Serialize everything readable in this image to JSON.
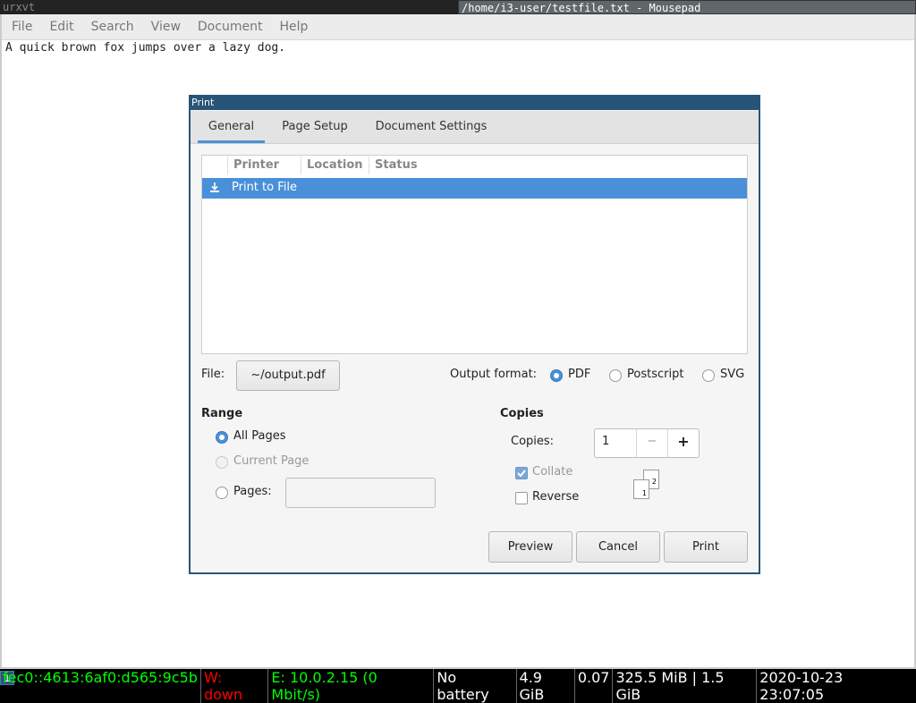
{
  "window_titles": {
    "left": "urxvt",
    "right": "/home/i3-user/testfile.txt - Mousepad"
  },
  "menubar": [
    "File",
    "Edit",
    "Search",
    "View",
    "Document",
    "Help"
  ],
  "editor": {
    "text": "A quick brown fox jumps over a lazy dog."
  },
  "dialog": {
    "title": "Print",
    "tabs": [
      {
        "label": "General",
        "active": true
      },
      {
        "label": "Page Setup",
        "active": false
      },
      {
        "label": "Document Settings",
        "active": false
      }
    ],
    "printer_list": {
      "columns": [
        "Printer",
        "Location",
        "Status"
      ],
      "rows": [
        {
          "icon": "download-icon",
          "name": "Print to File",
          "selected": true
        }
      ]
    },
    "file": {
      "label": "File:",
      "value": "~/output.pdf"
    },
    "output_format": {
      "label": "Output format:",
      "options": [
        "PDF",
        "Postscript",
        "SVG"
      ],
      "selected": "PDF"
    },
    "range": {
      "title": "Range",
      "options": [
        "All Pages",
        "Current Page",
        "Pages:"
      ],
      "selected": "All Pages",
      "pages_value": ""
    },
    "copies": {
      "title": "Copies",
      "label": "Copies:",
      "value": "1",
      "minus": "−",
      "plus": "+",
      "collate": {
        "label": "Collate",
        "checked": true,
        "enabled": false
      },
      "reverse": {
        "label": "Reverse",
        "checked": false
      },
      "preview_pages": [
        "2",
        "1"
      ]
    },
    "buttons": {
      "preview": "Preview",
      "cancel": "Cancel",
      "print": "Print"
    }
  },
  "statusbar": {
    "workspace": "1",
    "ipv6": "fec0::4613:6af0:d565:9c5b",
    "wifi": "W: down",
    "ethernet": "E: 10.0.2.15 (0 Mbit/s)",
    "battery": "No battery",
    "disk": "4.9 GiB",
    "load": "0.07",
    "memory": "325.5 MiB | 1.5 GiB",
    "datetime": "2020-10-23 23:07:05",
    "colors": {
      "good": "#00ff00",
      "bad": "#ff0000",
      "neutral": "#ffffff"
    }
  }
}
